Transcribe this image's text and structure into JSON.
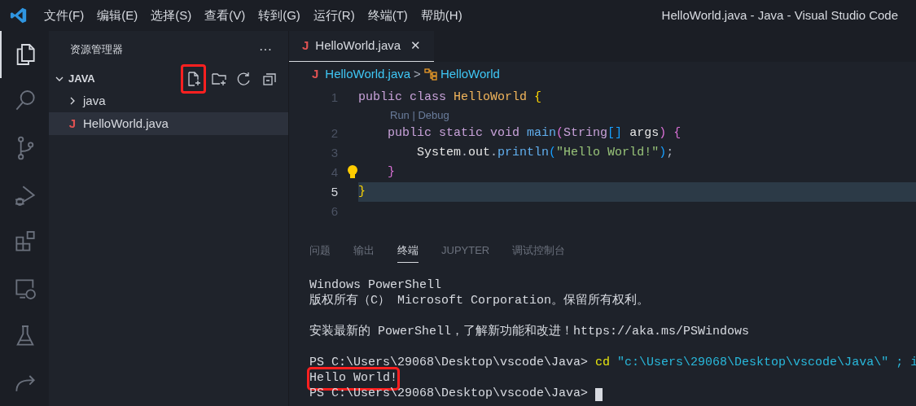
{
  "menu_bar": {
    "items": [
      "文件(F)",
      "编辑(E)",
      "选择(S)",
      "查看(V)",
      "转到(G)",
      "运行(R)",
      "终端(T)",
      "帮助(H)"
    ],
    "title": "HelloWorld.java - Java - Visual Studio Code"
  },
  "activity_bar": [
    {
      "kind": "files",
      "selected": true
    },
    {
      "kind": "search",
      "selected": false
    },
    {
      "kind": "git",
      "selected": false
    },
    {
      "kind": "debug",
      "selected": false
    },
    {
      "kind": "extensions",
      "selected": false
    },
    {
      "kind": "remote",
      "selected": false
    },
    {
      "kind": "testing",
      "selected": false
    },
    {
      "kind": "share",
      "selected": false
    }
  ],
  "sidebar": {
    "title": "资源管理器",
    "more": "···",
    "folder": {
      "name": "JAVA",
      "expanded": true
    },
    "actions": [
      {
        "kind": "new-file",
        "highlighted": true
      },
      {
        "kind": "new-folder",
        "highlighted": false
      },
      {
        "kind": "refresh",
        "highlighted": false
      },
      {
        "kind": "collapse",
        "highlighted": false
      }
    ],
    "items": [
      {
        "kind": "folder",
        "name": "java",
        "expanded": false,
        "selected": false
      },
      {
        "kind": "file",
        "icon": "J",
        "name": "HelloWorld.java",
        "selected": true
      }
    ]
  },
  "editor": {
    "tabs": [
      {
        "icon": "J",
        "label": "HelloWorld.java",
        "close": "✕",
        "selected": true
      }
    ],
    "breadcrumb": {
      "icon": "J",
      "file": "HelloWorld.java",
      "separator": ">",
      "symbol": "HelloWorld"
    },
    "lines": [
      {
        "number": "1",
        "current": false,
        "tokens": [
          {
            "kind": "keyword",
            "text": "public "
          },
          {
            "kind": "keyword",
            "text": "class "
          },
          {
            "kind": "type",
            "text": "HelloWorld "
          },
          {
            "kind": "brace1",
            "text": "{"
          }
        ]
      },
      {
        "kind": "codelens",
        "text": "Run | Debug"
      },
      {
        "number": "2",
        "current": false,
        "tokens": [
          {
            "kind": "keyword",
            "text": "    public "
          },
          {
            "kind": "keyword",
            "text": "static "
          },
          {
            "kind": "keyword",
            "text": "void "
          },
          {
            "kind": "function",
            "text": "main"
          },
          {
            "kind": "brace2",
            "text": "("
          },
          {
            "kind": "type2",
            "text": "String"
          },
          {
            "kind": "brace3",
            "text": "[]"
          },
          {
            "kind": "variable",
            "text": " args"
          },
          {
            "kind": "brace2",
            "text": ") {"
          }
        ]
      },
      {
        "number": "3",
        "current": false,
        "tokens": [
          {
            "kind": "variable",
            "text": "        System"
          },
          {
            "kind": "plain",
            "text": "."
          },
          {
            "kind": "variable",
            "text": "out"
          },
          {
            "kind": "plain",
            "text": "."
          },
          {
            "kind": "function",
            "text": "println"
          },
          {
            "kind": "brace3",
            "text": "("
          },
          {
            "kind": "string",
            "text": "\"Hello World!\""
          },
          {
            "kind": "brace3",
            "text": ")"
          },
          {
            "kind": "plain",
            "text": ";"
          }
        ]
      },
      {
        "number": "4",
        "current": false,
        "lightbulb": true,
        "tokens": [
          {
            "kind": "brace2",
            "text": "    }"
          }
        ]
      },
      {
        "number": "5",
        "current": true,
        "tokens": [
          {
            "kind": "brace1",
            "text": "}"
          }
        ]
      },
      {
        "number": "6",
        "current": false
      }
    ]
  },
  "panel": {
    "tabs": [
      {
        "label": "问题",
        "selected": false
      },
      {
        "label": "输出",
        "selected": false
      },
      {
        "label": "终端",
        "selected": true
      },
      {
        "label": "JUPYTER",
        "selected": false
      },
      {
        "label": "调试控制台",
        "selected": false
      }
    ],
    "terminal": [
      {
        "kind": "text",
        "text": "Windows PowerShell",
        "highlighted": false
      },
      {
        "kind": "text",
        "text": "版权所有（C） Microsoft Corporation。保留所有权利。",
        "highlighted": false
      },
      {
        "kind": "blank"
      },
      {
        "kind": "text",
        "text": "安装最新的 PowerShell，了解新功能和改进！https://aka.ms/PSWindows",
        "highlighted": false
      },
      {
        "kind": "blank"
      },
      {
        "kind": "prompt",
        "prompt": "PS C:\\Users\\29068\\Desktop\\vscode\\Java>",
        "command": "cd",
        "argument": "\"c:\\Users\\29068\\Desktop\\vscode\\Java\\\" ; i"
      },
      {
        "kind": "text",
        "text": "Hello World!",
        "highlighted": true
      },
      {
        "kind": "prompt",
        "prompt": "PS C:\\Users\\29068\\Desktop\\vscode\\Java>",
        "cursor": true
      }
    ]
  }
}
